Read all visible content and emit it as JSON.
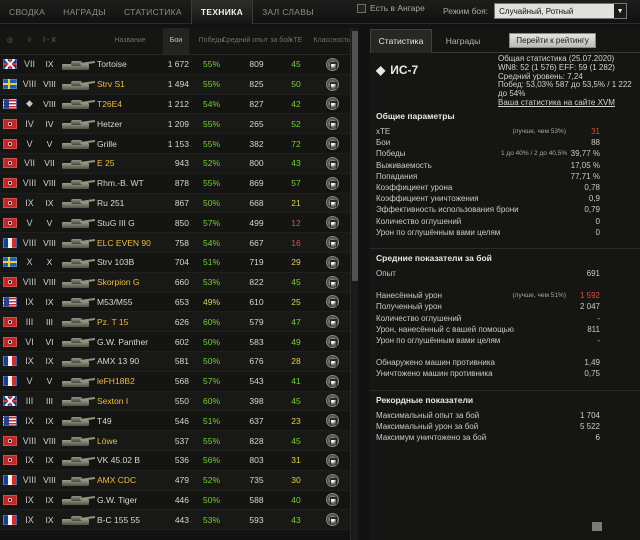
{
  "top": {
    "tabs": [
      "СВОДКА",
      "НАГРАДЫ",
      "СТАТИСТИКА",
      "ТЕХНИКА",
      "ЗАЛ СЛАВЫ"
    ],
    "active": "ТЕХНИКА",
    "hangar": "Есть в Ангаре",
    "mode_label": "Режим боя:",
    "mode_value": "Случайный, Ротный"
  },
  "table": {
    "headers": [
      "◎",
      "◊",
      "I - X",
      "Название",
      "Бои",
      "Победы",
      "Средний опыт за бой",
      "xTE",
      "Классность"
    ],
    "rows": [
      [
        "GB",
        "VII",
        "IX",
        "Tortoise",
        "1 672",
        "55%",
        "809",
        "45",
        "gold",
        "red"
      ],
      [
        "SE",
        "VIII",
        "VIII",
        "Strv S1",
        "1 494",
        "55%",
        "825",
        "50",
        "gold",
        "red"
      ],
      [
        "US",
        "◆",
        "VIII",
        "T26E4",
        "1 212",
        "54%",
        "827",
        "42",
        "gold",
        "red"
      ],
      [
        "DE",
        "IV",
        "IV",
        "Hetzer",
        "1 209",
        "55%",
        "265",
        "52",
        "gold",
        "red"
      ],
      [
        "DE",
        "V",
        "V",
        "Grille",
        "1 153",
        "55%",
        "382",
        "72",
        "gold",
        "red"
      ],
      [
        "DE",
        "VII",
        "VII",
        "E 25",
        "943",
        "52%",
        "800",
        "43",
        "gold",
        "red"
      ],
      [
        "DE",
        "VIII",
        "VIII",
        "Rhm.-B. WT",
        "878",
        "55%",
        "869",
        "57",
        "gold",
        "red"
      ],
      [
        "DE",
        "IX",
        "IX",
        "Ru 251",
        "867",
        "50%",
        "668",
        "21",
        "gold",
        "red"
      ],
      [
        "DE",
        "V",
        "V",
        "StuG III G",
        "850",
        "57%",
        "499",
        "12",
        "gold",
        "red"
      ],
      [
        "FR",
        "VIII",
        "VIII",
        "ELC EVEN 90",
        "758",
        "54%",
        "667",
        "16",
        "gold",
        "red"
      ],
      [
        "SE",
        "X",
        "X",
        "Strv 103B",
        "704",
        "51%",
        "719",
        "29",
        "gold",
        "red"
      ],
      [
        "DE",
        "VIII",
        "VIII",
        "Skorpion G",
        "660",
        "53%",
        "822",
        "45",
        "gold",
        "red"
      ],
      [
        "US",
        "IX",
        "IX",
        "M53/M55",
        "653",
        "49%",
        "610",
        "25",
        "gold",
        "red"
      ],
      [
        "DE",
        "III",
        "III",
        "Pz. T 15",
        "626",
        "60%",
        "579",
        "47",
        "gold",
        "red"
      ],
      [
        "DE",
        "VI",
        "VI",
        "G.W. Panther",
        "602",
        "50%",
        "583",
        "49",
        "gold",
        "red"
      ],
      [
        "FR",
        "IX",
        "IX",
        "AMX 13 90",
        "581",
        "50%",
        "676",
        "28",
        "gold",
        "red"
      ],
      [
        "FR",
        "V",
        "V",
        "leFH18B2",
        "568",
        "57%",
        "543",
        "41",
        "gold",
        "red"
      ],
      [
        "GB",
        "III",
        "III",
        "Sexton I",
        "550",
        "60%",
        "398",
        "45",
        "gold",
        "red"
      ],
      [
        "US",
        "IX",
        "IX",
        "T49",
        "546",
        "51%",
        "637",
        "23",
        "gold",
        "red"
      ],
      [
        "DE",
        "VIII",
        "VIII",
        "Löwe",
        "537",
        "55%",
        "828",
        "45",
        "gold",
        "red"
      ],
      [
        "DE",
        "IX",
        "IX",
        "VK 45.02 B",
        "536",
        "56%",
        "803",
        "31",
        "gold",
        "red"
      ],
      [
        "FR",
        "VIII",
        "VIII",
        "AMX CDC",
        "479",
        "52%",
        "735",
        "30",
        "gold",
        "red"
      ],
      [
        "DE",
        "IX",
        "IX",
        "G.W. Tiger",
        "446",
        "50%",
        "588",
        "40",
        "gold",
        "red"
      ],
      [
        "FR",
        "IX",
        "IX",
        "B-C 155 55",
        "443",
        "53%",
        "593",
        "43",
        "gold",
        "red"
      ]
    ]
  },
  "right": {
    "tabs": [
      "Статистика",
      "Награды"
    ],
    "button": "Перейти к рейтингу",
    "vehicle": "ИС-7",
    "summary": [
      "Общая статистика (25.07.2020)",
      "WN8: 52 (1 576) EFF: 59 (1 282)",
      "Средний уровень: 7,24",
      "Побед: 53,03% 587 до 53,5% / 1 222 до 54%",
      "Ваша статистика на сайте XVM"
    ],
    "sections": [
      {
        "title": "Общие параметры",
        "lines": [
          [
            "xTE",
            "(лучше, чем 53%)",
            "31"
          ],
          [
            "Бои",
            "",
            "88"
          ],
          [
            "Победы",
            "1 до 40% / 2 до 40,5%",
            "39,77 %"
          ],
          [
            "Выживаемость",
            "",
            "17,05 %"
          ],
          [
            "Попадания",
            "",
            "77,71 %"
          ],
          [
            "Коэффициент урона",
            "",
            "0,78"
          ],
          [
            "Коэффициент уничтожения",
            "",
            "0,9"
          ],
          [
            "Эффективность использования брони",
            "",
            "0,79"
          ],
          [
            "Количество оглушений",
            "",
            "0"
          ],
          [
            "Урон по оглушённым вами целям",
            "",
            "0"
          ]
        ]
      },
      {
        "title": "Средние показатели за бой",
        "lines": [
          [
            "Опыт",
            "",
            "691"
          ],
          [
            "Нанесённый урон",
            "(лучше, чем 51%)",
            "1 592"
          ],
          [
            "Полученный урон",
            "",
            "2 047"
          ],
          [
            "Количество оглушений",
            "",
            "-"
          ],
          [
            "Урон, нанесённый с вашей помощью",
            "",
            "811"
          ],
          [
            "Урон по оглушённым вами целям",
            "",
            "-"
          ],
          [
            "Обнаружено машин противника",
            "",
            "1,49"
          ],
          [
            "Уничтожено машин противника",
            "",
            "0,75"
          ]
        ]
      },
      {
        "title": "Рекордные показатели",
        "lines": [
          [
            "Максимальный опыт за бой",
            "",
            "1 704"
          ],
          [
            "Максимальный урон за бой",
            "",
            "5 522"
          ],
          [
            "Максимум уничтожено за бой",
            "",
            "6"
          ]
        ]
      }
    ]
  },
  "colors": {
    "green": "#75d22b",
    "yellow": "#dfd33f",
    "red": "#e64b3a",
    "gold": "#f1bf32"
  }
}
